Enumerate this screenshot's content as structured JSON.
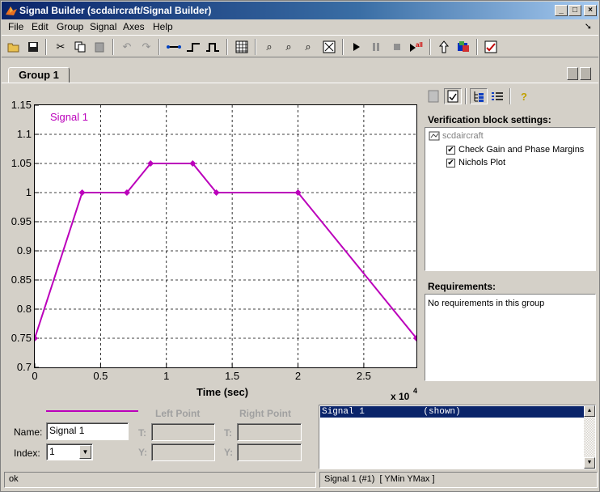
{
  "window": {
    "title": "Signal Builder (scdaircraft/Signal Builder)",
    "minimize": "_",
    "maximize": "□",
    "close": "×"
  },
  "menu": {
    "file": "File",
    "edit": "Edit",
    "group": "Group",
    "signal": "Signal",
    "axes": "Axes",
    "help": "Help"
  },
  "tab": {
    "label": "Group 1"
  },
  "legend": {
    "signal_label": "Signal 1"
  },
  "chart_data": {
    "type": "line",
    "title": "",
    "xlabel": "Time (sec)",
    "ylabel": "",
    "x_multiplier": "x 10",
    "x_multiplier_exp": "4",
    "xlim": [
      0,
      2.9
    ],
    "ylim": [
      0.7,
      1.15
    ],
    "xticks": [
      "0",
      "0.5",
      "1",
      "1.5",
      "2",
      "2.5"
    ],
    "xtick_values": [
      0,
      0.5,
      1,
      1.5,
      2,
      2.5
    ],
    "yticks": [
      "0.7",
      "0.75",
      "0.8",
      "0.85",
      "0.9",
      "0.95",
      "1",
      "1.05",
      "1.1",
      "1.15"
    ],
    "ytick_values": [
      0.7,
      0.75,
      0.8,
      0.85,
      0.9,
      0.95,
      1,
      1.05,
      1.1,
      1.15
    ],
    "grid": true,
    "series": [
      {
        "name": "Signal 1",
        "color": "#bb00bb",
        "x": [
          0,
          0.36,
          0.7,
          0.88,
          1.2,
          1.38,
          2.0,
          2.9
        ],
        "y": [
          0.75,
          1.0,
          1.0,
          1.05,
          1.05,
          1.0,
          1.0,
          0.75
        ]
      }
    ]
  },
  "right_panel": {
    "verification_title": "Verification block settings:",
    "tree_root": "scdaircraft",
    "tree_items": [
      {
        "label": "Check Gain and Phase Margins",
        "checked": true
      },
      {
        "label": "Nichols Plot",
        "checked": true
      }
    ],
    "requirements_title": "Requirements:",
    "requirements_text": "No requirements in this group"
  },
  "bottom": {
    "left_point": "Left Point",
    "right_point": "Right Point",
    "name_label": "Name:",
    "name_value": "Signal 1",
    "index_label": "Index:",
    "index_value": "1",
    "t_label": "T:",
    "y_label": "Y:",
    "signal_list_row": "Signal 1           (shown)"
  },
  "status": {
    "left": "ok",
    "right": "Signal 1 (#1)  [ YMin YMax ]"
  },
  "colors": {
    "title_bar_start": "#0a246a",
    "signal": "#bb00bb",
    "selection": "#0a246a"
  }
}
